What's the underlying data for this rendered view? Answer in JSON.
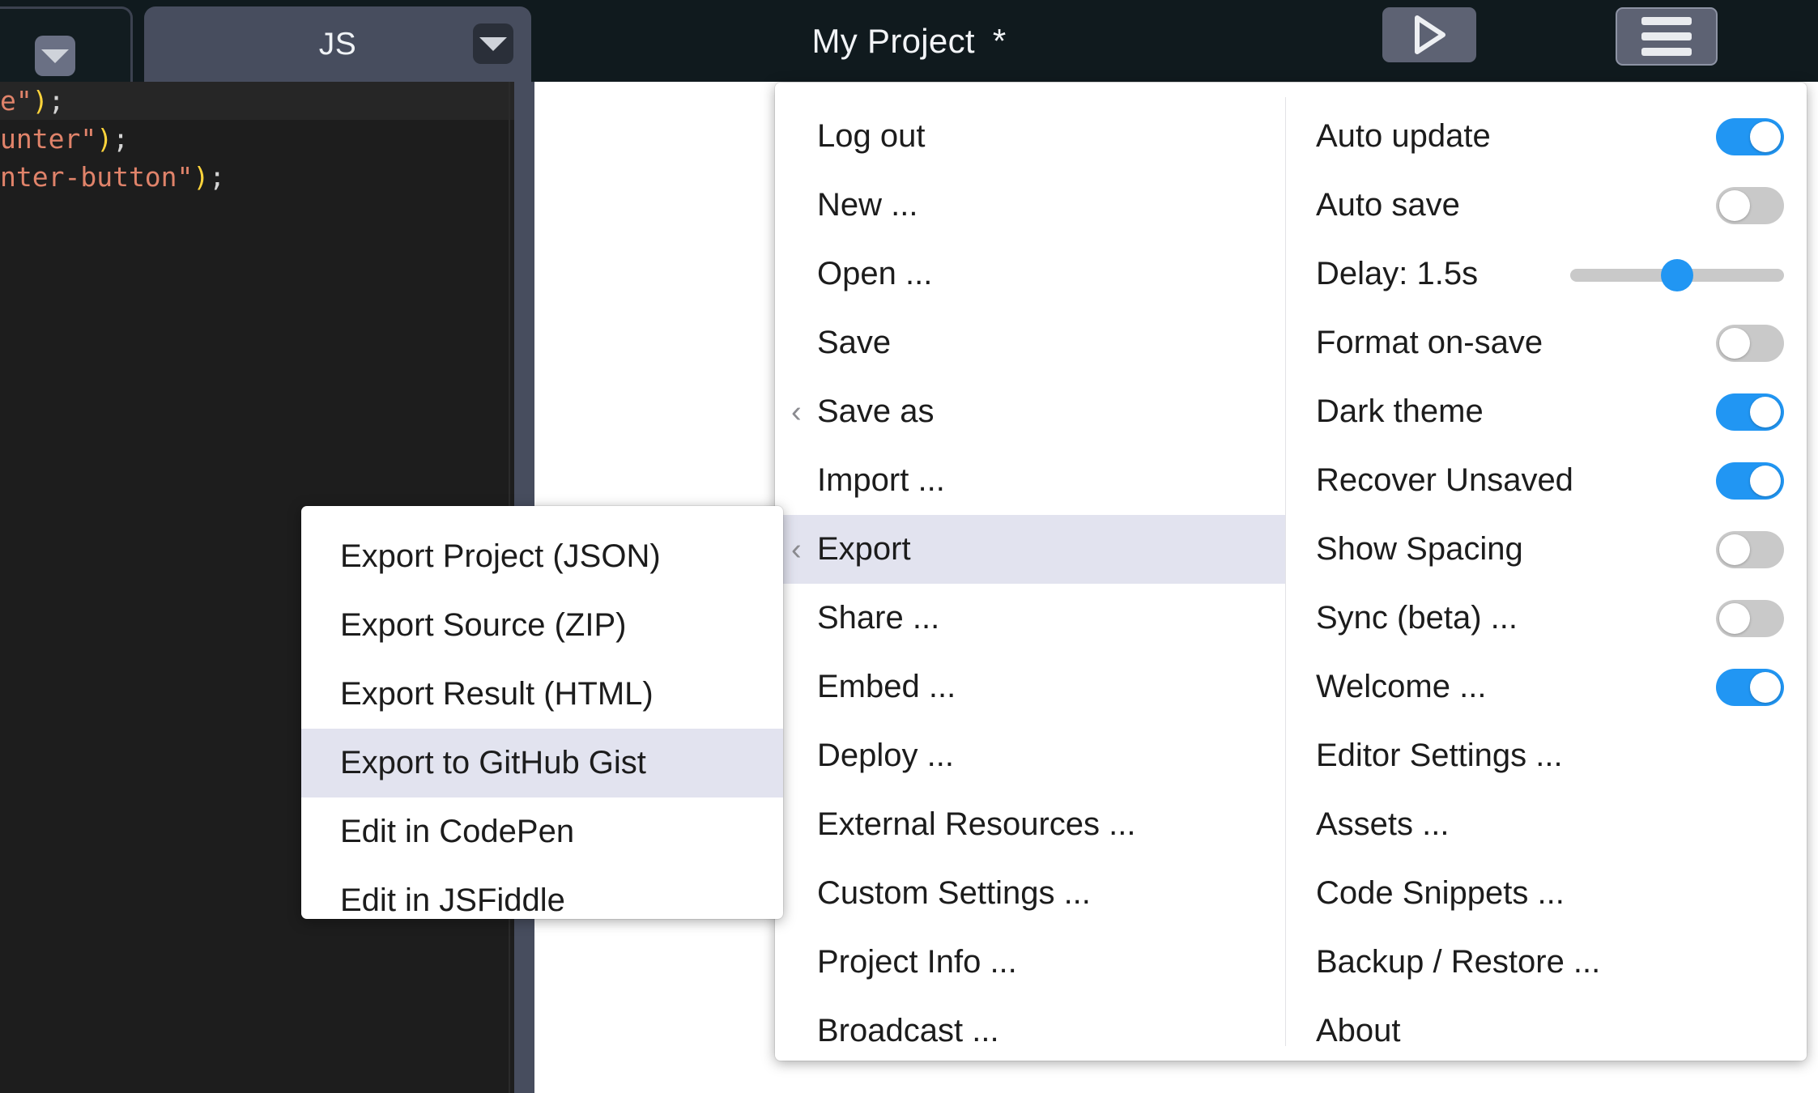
{
  "app": {
    "title": "My Project",
    "dirty_marker": "*",
    "accent_color": "#2196f3",
    "highlight_color": "#e2e3ef",
    "topbar_color": "#101a1e"
  },
  "topbar": {
    "tabs": [
      {
        "label": "",
        "caret_icon": "chevron-down-icon",
        "active": false
      },
      {
        "label": "JS",
        "caret_icon": "chevron-down-icon",
        "active": true
      }
    ],
    "run_button": {
      "icon": "play-icon",
      "label": "Run"
    },
    "menu_button": {
      "icon": "hamburger-menu-icon",
      "label": "Menu"
    }
  },
  "editor": {
    "language": "JS",
    "lines": [
      {
        "highlighted": true,
        "tokens": [
          {
            "text": "e\"",
            "type": "str"
          },
          {
            "text": ")",
            "type": "paren"
          },
          {
            "text": ";",
            "type": "punc"
          }
        ]
      },
      {
        "highlighted": false,
        "tokens": [
          {
            "text": "unter\"",
            "type": "str"
          },
          {
            "text": ")",
            "type": "paren"
          },
          {
            "text": ";",
            "type": "punc"
          }
        ]
      },
      {
        "highlighted": false,
        "tokens": [
          {
            "text": "nter-button\"",
            "type": "str"
          },
          {
            "text": ")",
            "type": "paren"
          },
          {
            "text": ";",
            "type": "punc"
          }
        ]
      }
    ]
  },
  "main_menu": {
    "left_column": [
      {
        "label": "Log out",
        "has_submenu": false,
        "highlighted": false
      },
      {
        "label": "New ...",
        "has_submenu": false,
        "highlighted": false
      },
      {
        "label": "Open ...",
        "has_submenu": false,
        "highlighted": false
      },
      {
        "label": "Save",
        "has_submenu": false,
        "highlighted": false
      },
      {
        "label": "Save as",
        "has_submenu": true,
        "highlighted": false
      },
      {
        "label": "Import ...",
        "has_submenu": false,
        "highlighted": false
      },
      {
        "label": "Export",
        "has_submenu": true,
        "highlighted": true
      },
      {
        "label": "Share ...",
        "has_submenu": false,
        "highlighted": false
      },
      {
        "label": "Embed ...",
        "has_submenu": false,
        "highlighted": false
      },
      {
        "label": "Deploy ...",
        "has_submenu": false,
        "highlighted": false
      },
      {
        "label": "External Resources ...",
        "has_submenu": false,
        "highlighted": false
      },
      {
        "label": "Custom Settings ...",
        "has_submenu": false,
        "highlighted": false
      },
      {
        "label": "Project Info ...",
        "has_submenu": false,
        "highlighted": false
      },
      {
        "label": "Broadcast ...",
        "has_submenu": false,
        "highlighted": false
      }
    ],
    "right_column": [
      {
        "label": "Auto update",
        "control": "toggle",
        "value": "on"
      },
      {
        "label": "Auto save",
        "control": "toggle",
        "value": "off"
      },
      {
        "label": "Delay: 1.5s",
        "control": "slider",
        "value": 1.5,
        "slider_percent": 50
      },
      {
        "label": "Format on-save",
        "control": "toggle",
        "value": "off"
      },
      {
        "label": "Dark theme",
        "control": "toggle",
        "value": "on"
      },
      {
        "label": "Recover Unsaved",
        "control": "toggle",
        "value": "on"
      },
      {
        "label": "Show Spacing",
        "control": "toggle",
        "value": "off"
      },
      {
        "label": "Sync (beta) ...",
        "control": "toggle",
        "value": "off"
      },
      {
        "label": "Welcome ...",
        "control": "toggle",
        "value": "on"
      },
      {
        "label": "Editor Settings ...",
        "control": "none"
      },
      {
        "label": "Assets ...",
        "control": "none"
      },
      {
        "label": "Code Snippets ...",
        "control": "none"
      },
      {
        "label": "Backup / Restore ...",
        "control": "none"
      },
      {
        "label": "About",
        "control": "none"
      }
    ]
  },
  "export_submenu": {
    "items": [
      {
        "label": "Export Project (JSON)",
        "highlighted": false
      },
      {
        "label": "Export Source (ZIP)",
        "highlighted": false
      },
      {
        "label": "Export Result (HTML)",
        "highlighted": false
      },
      {
        "label": "Export to GitHub Gist",
        "highlighted": true
      },
      {
        "label": "Edit in CodePen",
        "highlighted": false
      },
      {
        "label": "Edit in JSFiddle",
        "highlighted": false
      }
    ]
  },
  "icons": {
    "back_chevron": "‹",
    "caret_down": "chevron-down-icon",
    "play": "play-icon",
    "hamburger": "hamburger-menu-icon"
  }
}
